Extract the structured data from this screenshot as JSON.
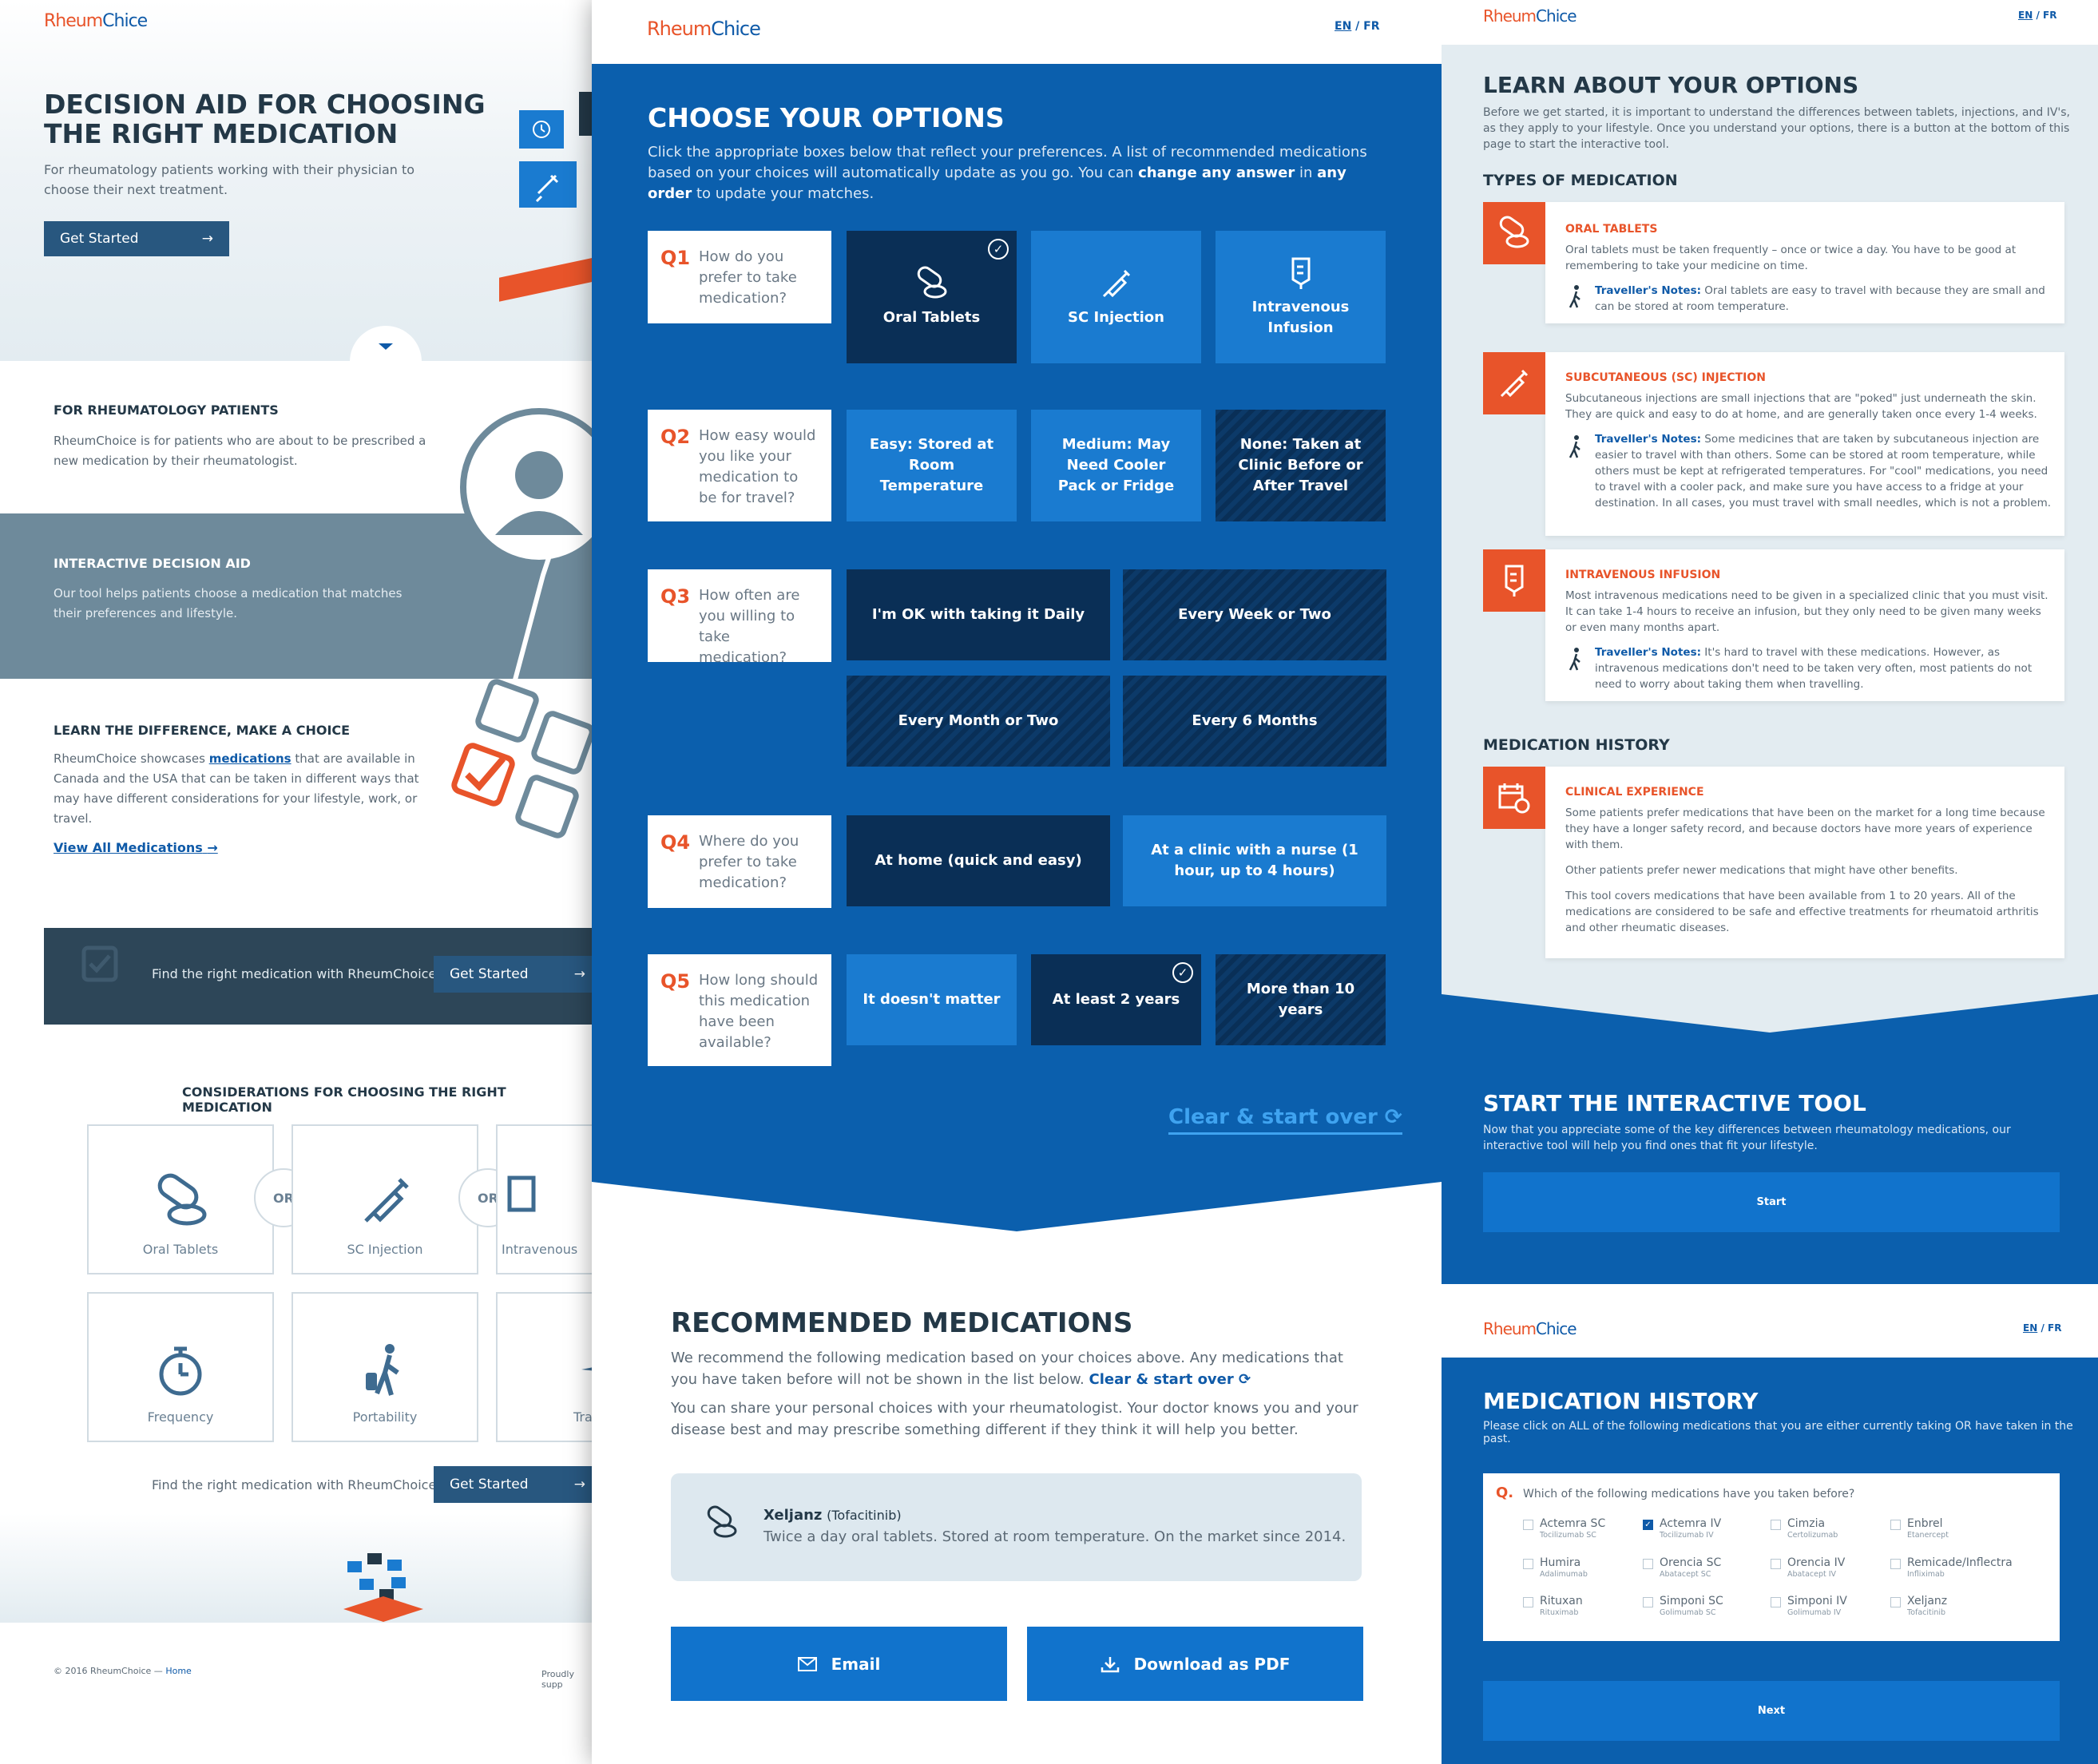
{
  "brand": {
    "logo_part1": "Rheum",
    "logo_part2": "Ch",
    "logo_part3": "ice"
  },
  "colors": {
    "accent": "#e8542a",
    "primary_blue": "#0b5fad",
    "dark_navy": "#0a2f56",
    "light_blue": "#1a7bd0"
  },
  "left": {
    "hero_title": "DECISION AID FOR CHOOSING THE RIGHT MEDICATION",
    "hero_sub": "For rheumatology patients working with their physician to choose their next treatment.",
    "get_started": "Get Started",
    "patients_title": "FOR RHEUMATOLOGY PATIENTS",
    "patients_text": "RheumChoice is for patients who are about to be prescribed a new medication by their rheumatologist.",
    "interactive_title": "INTERACTIVE DECISION AID",
    "interactive_text": "Our tool helps patients choose a medication that matches their preferences and lifestyle.",
    "learn_title": "LEARN THE DIFFERENCE, MAKE A CHOICE",
    "learn_text_before": "RheumChoice showcases ",
    "learn_link": "medications",
    "learn_text_after": " that are available in Canada and the USA that can be taken in different ways that may have different considerations for your lifestyle, work, or travel.",
    "view_all": "View All Medications",
    "cta_text": "Find the right medication with RheumChoice",
    "considerations_title": "CONSIDERATIONS FOR CHOOSING THE RIGHT MEDICATION",
    "cons": [
      "Oral Tablets",
      "SC Injection",
      "Intravenous",
      "Frequency",
      "Portability",
      "Tra"
    ],
    "or_label": "OR",
    "footer_copy": "© 2016 RheumChoice — ",
    "footer_home": "Home",
    "footer_right": "Proudly supp"
  },
  "mid": {
    "lang_en": "EN",
    "lang_sep": "/",
    "lang_fr": "FR",
    "title": "CHOOSE YOUR OPTIONS",
    "intro_1": "Click the appropriate boxes below that reflect your preferences. A list of recommended medications based on your choices will automatically update as you go. You can ",
    "intro_b1": "change any answer",
    "intro_2": " in ",
    "intro_b2": "any order",
    "intro_3": " to update your matches.",
    "questions": [
      {
        "num": "Q1",
        "text": "How do you prefer to take medication?"
      },
      {
        "num": "Q2",
        "text": "How easy would you like your medication to be for travel?"
      },
      {
        "num": "Q3",
        "text": "How often are you willing to take medication?"
      },
      {
        "num": "Q4",
        "text": "Where do you prefer to take medication?"
      },
      {
        "num": "Q5",
        "text": "How long should this medication have been available?"
      }
    ],
    "q1_opts": [
      "Oral Tablets",
      "SC Injection",
      "Intravenous Infusion"
    ],
    "q2_opts": [
      "Easy: Stored at Room Temperature",
      "Medium: May Need Cooler Pack or Fridge",
      "None: Taken at Clinic Before or After Travel"
    ],
    "q3_opts": [
      "I'm OK with taking it Daily",
      "Every Week or Two",
      "Every Month or Two",
      "Every 6 Months"
    ],
    "q4_opts": [
      "At home (quick and easy)",
      "At a clinic with a nurse (1 hour, up to 4 hours)"
    ],
    "q5_opts": [
      "It doesn't matter",
      "At least 2 years",
      "More than 10 years"
    ],
    "clear": "Clear & start over",
    "rec_title": "RECOMMENDED MEDICATIONS",
    "rec_text_1": "We recommend the following medication based on your choices above. Any medications that you have taken before will not be shown in the list below. ",
    "rec_clear": "Clear & start over",
    "rec_text_2": "You can share your personal choices with your rheumatologist. Your doctor knows you and your disease best and may prescribe something different if they think it will help you better.",
    "med_name": "Xeljanz",
    "med_generic": "(Tofacitinib)",
    "med_desc": "Twice a day oral tablets. Stored at room temperature. On the market since 2014.",
    "email": "Email",
    "pdf": "Download as PDF"
  },
  "rt": {
    "lang_en": "EN",
    "lang_sep": "/",
    "lang_fr": "FR",
    "title": "LEARN ABOUT YOUR OPTIONS",
    "intro": "Before we get started, it is important to understand the differences between tablets, injections, and IV's, as they apply to your lifestyle. Once you understand your options, there is a button at the bottom of this page to start the interactive tool.",
    "types_title": "TYPES OF MEDICATION",
    "tn_label": "Traveller's Notes:",
    "oral_title": "ORAL TABLETS",
    "oral_text": "Oral tablets must be taken frequently – once or twice a day. You have to be good at remembering to take your medicine on time.",
    "oral_note": " Oral tablets are easy to travel with because they are small and can be stored at room temperature.",
    "sc_title": "SUBCUTANEOUS (SC) INJECTION",
    "sc_text": "Subcutaneous injections are small injections that are \"poked\" just underneath the skin. They are quick and easy to do at home, and are generally taken once every 1-4 weeks.",
    "sc_note": " Some medicines that are taken by subcutaneous injection are easier to travel with than others. Some can be stored at room temperature, while others must be kept at refrigerated temperatures. For \"cool\" medications, you need to travel with a cooler pack, and make sure you have access to a fridge at your destination. In all cases, you must travel with small needles, which is not a problem.",
    "iv_title": "INTRAVENOUS INFUSION",
    "iv_text": "Most intravenous medications need to be given in a specialized clinic that you must visit. It can take 1-4 hours to receive an infusion, but they only need to be given many weeks or even many months apart.",
    "iv_note": " It's hard to travel with these medications. However, as intravenous medications don't need to be taken very often, most patients do not need to worry about taking them when travelling.",
    "history_title": "MEDICATION HISTORY",
    "clinical_title": "CLINICAL EXPERIENCE",
    "clinical_p1": "Some patients prefer medications that have been on the market for a long time because they have a longer safety record, and because doctors have more years of experience with them.",
    "clinical_p2": "Other patients prefer newer medications that might have other benefits.",
    "clinical_p3": "This tool covers medications that have been available from 1 to 20 years. All of the medications are considered to be safe and effective treatments for rheumatoid arthritis and other rheumatic diseases.",
    "start_title": "START THE INTERACTIVE TOOL",
    "start_text": "Now that you appreciate some of the key differences between rheumatology medications, our interactive tool will help you find ones that fit your lifestyle.",
    "start_btn": "Start"
  },
  "rb": {
    "lang_en": "EN",
    "lang_sep": "/",
    "lang_fr": "FR",
    "title": "MEDICATION HISTORY",
    "sub": "Please click on ALL of the following medications that you are either currently taking OR have taken in the past.",
    "q_label": "Q.",
    "question": "Which of the following medications have you taken before?",
    "meds": [
      {
        "name": "Actemra SC",
        "generic": "Tocilizumab SC",
        "checked": false
      },
      {
        "name": "Actemra IV",
        "generic": "Tocilizumab IV",
        "checked": true
      },
      {
        "name": "Cimzia",
        "generic": "Certolizumab",
        "checked": false
      },
      {
        "name": "Enbrel",
        "generic": "Etanercept",
        "checked": false
      },
      {
        "name": "Humira",
        "generic": "Adalimumab",
        "checked": false
      },
      {
        "name": "Orencia SC",
        "generic": "Abatacept SC",
        "checked": false
      },
      {
        "name": "Orencia IV",
        "generic": "Abatacept IV",
        "checked": false
      },
      {
        "name": "Remicade/Inflectra",
        "generic": "Infliximab",
        "checked": false
      },
      {
        "name": "Rituxan",
        "generic": "Rituximab",
        "checked": false
      },
      {
        "name": "Simponi SC",
        "generic": "Golimumab SC",
        "checked": false
      },
      {
        "name": "Simponi IV",
        "generic": "Golimumab IV",
        "checked": false
      },
      {
        "name": "Xeljanz",
        "generic": "Tofacitinib",
        "checked": false
      }
    ],
    "next": "Next"
  }
}
